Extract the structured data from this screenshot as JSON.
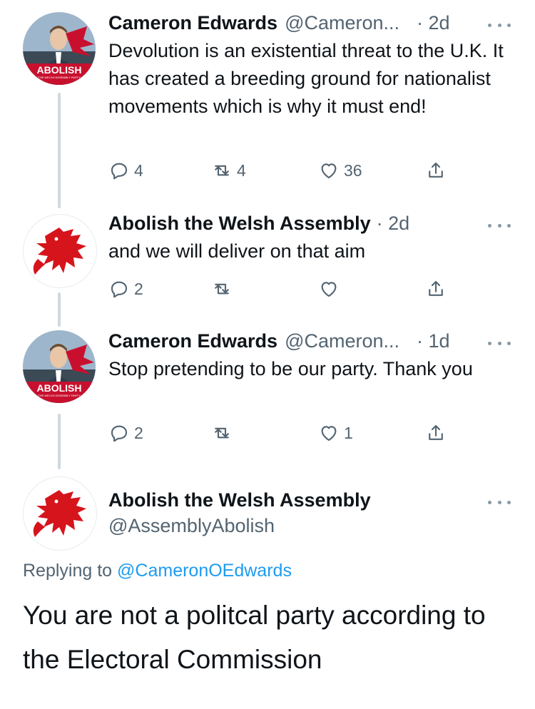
{
  "tweets": [
    {
      "name": "Cameron Edwards",
      "handle": "@Cameron...",
      "time": "· 2d",
      "text": "Devolution is an existential threat to the U.K. It has created a breeding ground for nationalist movements which is why it must end!",
      "replies": "4",
      "retweets": "4",
      "likes": "36",
      "avatar_label": "ABOLISH",
      "avatar_sublabel": "THE WELSH ASSEMBLY PARTY"
    },
    {
      "name": "Abolish the Welsh Assembly",
      "time": "· 2d",
      "text": "and we will deliver on that aim",
      "replies": "2",
      "retweets": "",
      "likes": ""
    },
    {
      "name": "Cameron Edwards",
      "handle": "@Cameron...",
      "time": "· 1d",
      "text": "Stop pretending to be our party. Thank you",
      "replies": "2",
      "retweets": "",
      "likes": "1",
      "avatar_label": "ABOLISH",
      "avatar_sublabel": "THE WELSH ASSEMBLY PARTY"
    }
  ],
  "main_tweet": {
    "name": "Abolish the Welsh Assembly",
    "handle": "@AssemblyAbolish",
    "replying_prefix": "Replying to",
    "replying_to": "@CameronOEdwards",
    "text": "You are not a politcal party according to the Electoral Commission"
  },
  "colors": {
    "accent": "#1d9bf0",
    "muted": "#536471",
    "dragon_red": "#d6141c",
    "banner_red": "#c8102e"
  },
  "icons": [
    "reply-icon",
    "retweet-icon",
    "like-icon",
    "share-icon",
    "more-icon",
    "dragon-icon"
  ]
}
